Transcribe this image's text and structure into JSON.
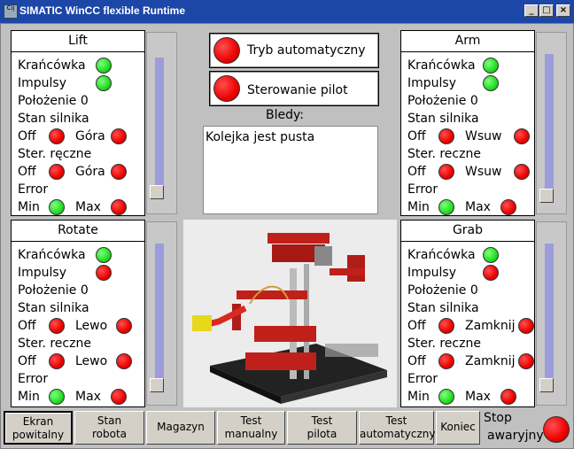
{
  "window": {
    "title": "SIMATIC WinCC flexible Runtime",
    "icon_text": "Cij",
    "minimize": "_",
    "maximize": "□",
    "close": "×"
  },
  "panels": {
    "lift": {
      "title": "Lift",
      "limit_switch": "Krańcówka",
      "pulses": "Impulsy",
      "position": "Położenie 0",
      "motor_state": "Stan silnika",
      "off": "Off",
      "dir_a": "Góra",
      "manual": "Ster. ręczne",
      "error": "Error",
      "min": "Min",
      "max": "Max"
    },
    "arm": {
      "title": "Arm",
      "limit_switch": "Krańcówka",
      "pulses": "Impulsy",
      "position": "Położenie 0",
      "motor_state": "Stan silnika",
      "off": "Off",
      "dir_a": "Wsuw",
      "manual": "Ster. reczne",
      "error": "Error",
      "min": "Min",
      "max": "Max"
    },
    "rotate": {
      "title": "Rotate",
      "limit_switch": "Krańcówka",
      "pulses": "Impulsy",
      "position": "Położenie 0",
      "motor_state": "Stan silnika",
      "off": "Off",
      "dir_a": "Lewo",
      "manual": "Ster. reczne",
      "error": "Error",
      "min": "Min",
      "max": "Max"
    },
    "grab": {
      "title": "Grab",
      "limit_switch": "Krańcówka",
      "pulses": "Impulsy",
      "position": "Położenie 0",
      "motor_state": "Stan silnika",
      "off": "Off",
      "dir_a": "Zamknij",
      "manual": "Ster. reczne",
      "error": "Error",
      "min": "Min",
      "max": "Max"
    }
  },
  "mode": {
    "auto_label": "Tryb automatyczny",
    "pilot_label": "Sterowanie pilot"
  },
  "errors": {
    "label": "Bledy:",
    "text": "Kolejka jest pusta"
  },
  "nav": [
    {
      "line1": "Ekran",
      "line2": "powitalny"
    },
    {
      "line1": "Stan",
      "line2": "robota"
    },
    {
      "line1": "Magazyn",
      "line2": ""
    },
    {
      "line1": "Test",
      "line2": "manualny"
    },
    {
      "line1": "Test",
      "line2": "pilota"
    },
    {
      "line1": "Test",
      "line2": "automatyczny"
    },
    {
      "line1": "Koniec",
      "line2": ""
    }
  ],
  "estop": {
    "line1": "Stop",
    "line2": "awaryjny"
  },
  "colors": {
    "led_on_green": "#22dd22",
    "led_red": "#ee0000",
    "titlebar": "#1c46a8",
    "slider_track": "#9c9cdc"
  }
}
